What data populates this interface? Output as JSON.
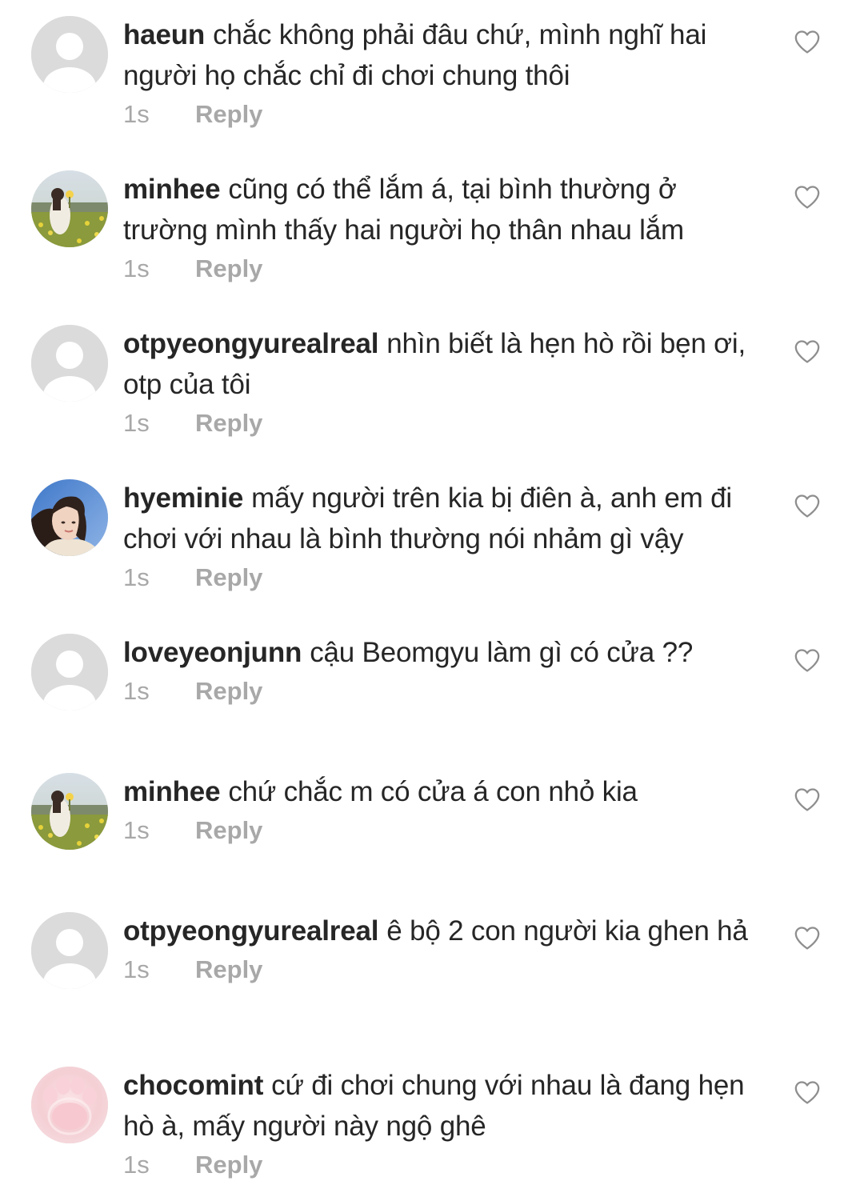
{
  "colors": {
    "text": "#262626",
    "muted": "#a8a8a8",
    "placeholder_bg": "#dbdbdb"
  },
  "comments": [
    {
      "username": "haeun",
      "text": "chắc không phải đâu chứ, mình nghĩ hai người họ chắc chỉ đi chơi chung thôi",
      "time": "1s",
      "reply": "Reply",
      "avatar": "default-avatar-icon"
    },
    {
      "username": "minhee",
      "text": "cũng có thể lắm á, tại bình thường ở trường mình thấy hai người họ thân nhau lắm",
      "time": "1s",
      "reply": "Reply",
      "avatar": "photo-flower-field"
    },
    {
      "username": "otpyeongyurealreal",
      "text": "nhìn biết là hẹn hò rồi bẹn ơi, otp của tôi",
      "time": "1s",
      "reply": "Reply",
      "avatar": "default-avatar-icon"
    },
    {
      "username": "hyeminie",
      "text": "mấy người trên kia bị điên à, anh em đi chơi với nhau là bình thường nói nhảm gì vậy",
      "time": "1s",
      "reply": "Reply",
      "avatar": "photo-girl-portrait"
    },
    {
      "username": "loveyeonjunn",
      "text": "cậu Beomgyu làm gì có cửa ??",
      "time": "1s",
      "reply": "Reply",
      "avatar": "default-avatar-icon"
    },
    {
      "username": "minhee",
      "text": "chứ chắc m có cửa á con nhỏ kia",
      "time": "1s",
      "reply": "Reply",
      "avatar": "photo-flower-field"
    },
    {
      "username": "otpyeongyurealreal",
      "text": "ê bộ 2 con người kia ghen hả",
      "time": "1s",
      "reply": "Reply",
      "avatar": "default-avatar-icon"
    },
    {
      "username": "chocomint",
      "text": "cứ đi chơi chung với nhau là đang hẹn hò à, mấy người này ngộ ghê",
      "time": "1s",
      "reply": "Reply",
      "avatar": "photo-pink-paw"
    }
  ]
}
